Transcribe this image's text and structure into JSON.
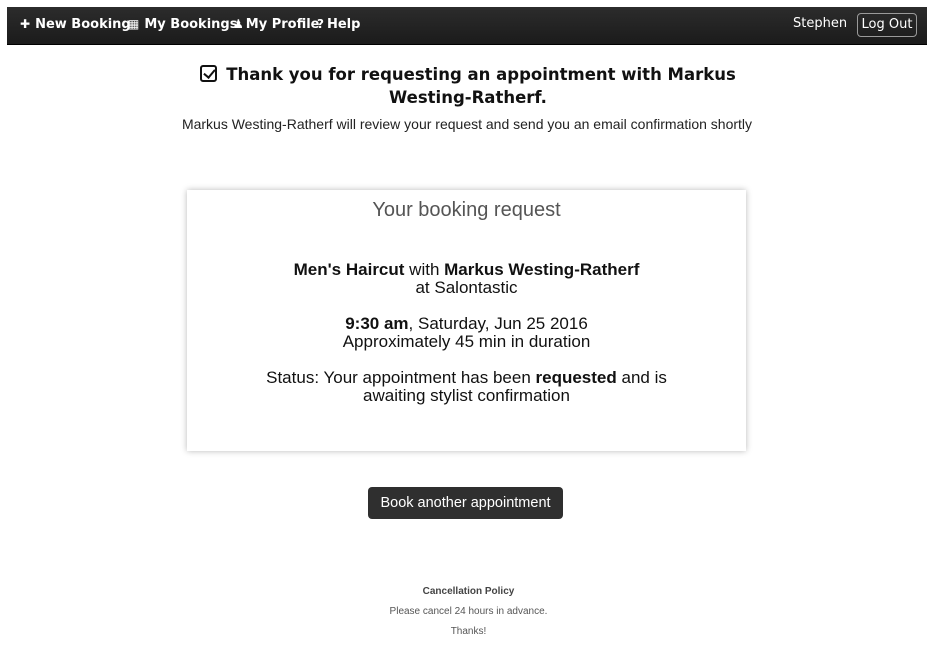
{
  "navbar": {
    "new_booking": "New Booking",
    "my_bookings": "My Bookings",
    "my_profile": "My Profile",
    "help": "Help",
    "user_name": "Stephen",
    "logout": "Log Out"
  },
  "confirmation": {
    "heading": "Thank you for requesting an appointment with Markus Westing-Ratherf.",
    "subtext": "Markus Westing-Ratherf will review your request and send you an email confirmation shortly"
  },
  "booking": {
    "title": "Your booking request",
    "service": "Men's Haircut",
    "with_word": "with",
    "stylist": "Markus Westing-Ratherf",
    "location": "at Salontastic",
    "time": "9:30 am",
    "date": ", Saturday, Jun 25 2016",
    "duration": "Approximately 45 min in duration",
    "status_prefix": "Status: Your appointment has been",
    "status_bold": "requested",
    "status_suffix": "and is",
    "status_line2": "awaiting stylist confirmation"
  },
  "actions": {
    "book_another": "Book another appointment"
  },
  "footer": {
    "policy_title": "Cancellation Policy",
    "policy_text": "Please cancel 24 hours in advance.",
    "thanks": "Thanks!"
  }
}
